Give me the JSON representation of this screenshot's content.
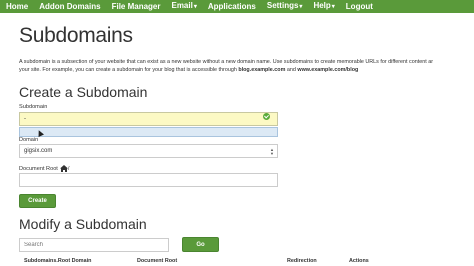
{
  "nav": {
    "items": [
      {
        "label": "Home",
        "caret": ""
      },
      {
        "label": "Addon Domains",
        "caret": ""
      },
      {
        "label": "File Manager",
        "caret": ""
      },
      {
        "label": "Email",
        "caret": "▾"
      },
      {
        "label": "Applications",
        "caret": ""
      },
      {
        "label": "Settings",
        "caret": "▾"
      },
      {
        "label": "Help",
        "caret": "▾"
      },
      {
        "label": "Logout",
        "caret": ""
      }
    ]
  },
  "page": {
    "title": "Subdomains",
    "intro_line1": "A subdomain is a subsection of your website that can exist as a new website without a new domain name. Use subdomains to create memorable URLs for different content ar",
    "intro_line2_pre": "your site. For example, you can create a subdomain for your blog that is accessible through ",
    "intro_line2_b1": "blog.example.com",
    "intro_line2_mid": " and ",
    "intro_line2_b2": "www.example.com/blog"
  },
  "create": {
    "title": "Create a Subdomain",
    "subdomain_label": "Subdomain",
    "subdomain_value": "-",
    "domain_label": "Domain",
    "domain_value": "gigsix.com",
    "docroot_label": "Document Root",
    "docroot_suffix": "/",
    "docroot_value": "",
    "create_button": "Create"
  },
  "modify": {
    "title": "Modify a Subdomain",
    "search_placeholder": "Search",
    "go_button": "Go",
    "columns": [
      "Subdomains.Root Domain",
      "Document Root",
      "Redirection",
      "Actions"
    ]
  },
  "icons": {
    "valid": "check-circle-icon",
    "home": "home-icon",
    "select": "select-arrows-icon",
    "cursor": "mouse-cursor-icon"
  },
  "colors": {
    "nav_bg": "#5a9a3a",
    "button_bg": "#5a9a3a",
    "input_highlight": "#fcf9c4",
    "suggestion_bg": "#dce9f5"
  }
}
